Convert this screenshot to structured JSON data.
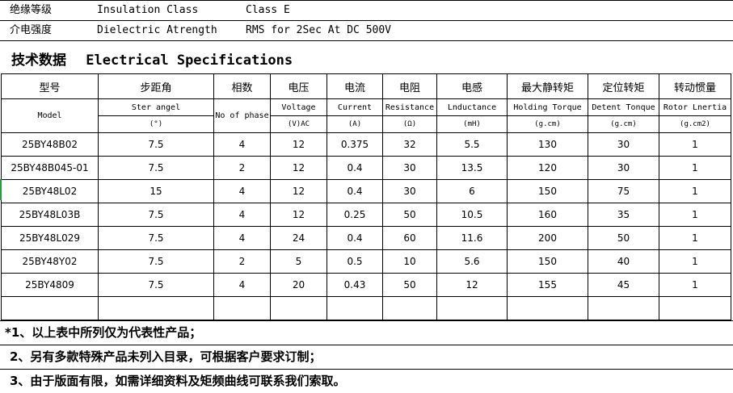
{
  "info_rows": [
    {
      "cn": "绝缘等级",
      "en": "Insulation Class",
      "value": "Class E"
    },
    {
      "cn": "介电强度",
      "en": "Dielectric Atrength",
      "value": "RMS for 2Sec  At DC 500V"
    }
  ],
  "section": {
    "cn": "技术数据",
    "en": "Electrical Specifications"
  },
  "table": {
    "headers_cn": [
      "型号",
      "步距角",
      "相数",
      "电压",
      "电流",
      "电阻",
      "电感",
      "最大静转矩",
      "定位转矩",
      "转动惯量"
    ],
    "headers_en": [
      "Model",
      "Ster angel",
      "No of phase",
      "Voltage",
      "Current",
      "Resistance",
      "Lnductance",
      "Holding Torque",
      "Detent Tonque",
      "Rotor Lnertia"
    ],
    "units": [
      "(°)",
      "(V)AC",
      "(A)",
      "(Ω)",
      "(mH)",
      "(g.cm)",
      "(g.cm)",
      "(g.cm2)"
    ],
    "rows": [
      [
        "25BY48B02",
        "7.5",
        "4",
        "12",
        "0.375",
        "32",
        "5.5",
        "130",
        "30",
        "1"
      ],
      [
        "25BY48B045-01",
        "7.5",
        "2",
        "12",
        "0.4",
        "30",
        "13.5",
        "120",
        "30",
        "1"
      ],
      [
        "25BY48L02",
        "15",
        "4",
        "12",
        "0.4",
        "30",
        "6",
        "150",
        "75",
        "1"
      ],
      [
        "25BY48L03B",
        "7.5",
        "4",
        "12",
        "0.25",
        "50",
        "10.5",
        "160",
        "35",
        "1"
      ],
      [
        "25BY48L029",
        "7.5",
        "4",
        "24",
        "0.4",
        "60",
        "11.6",
        "200",
        "50",
        "1"
      ],
      [
        "25BY48Y02",
        "7.5",
        "2",
        "5",
        "0.5",
        "10",
        "5.6",
        "150",
        "40",
        "1"
      ],
      [
        "25BY4809",
        "7.5",
        "4",
        "20",
        "0.43",
        "50",
        "12",
        "155",
        "45",
        "1"
      ]
    ]
  },
  "notes": [
    "*1、以上表中所列仅为代表性产品；",
    "2、另有多款特殊产品未列入目录，可根据客户要求订制；",
    "3、由于版面有限，如需详细资料及矩频曲线可联系我们索取。"
  ],
  "colors": {
    "border": "#000000",
    "selection_mark": "#2e9a3f"
  }
}
